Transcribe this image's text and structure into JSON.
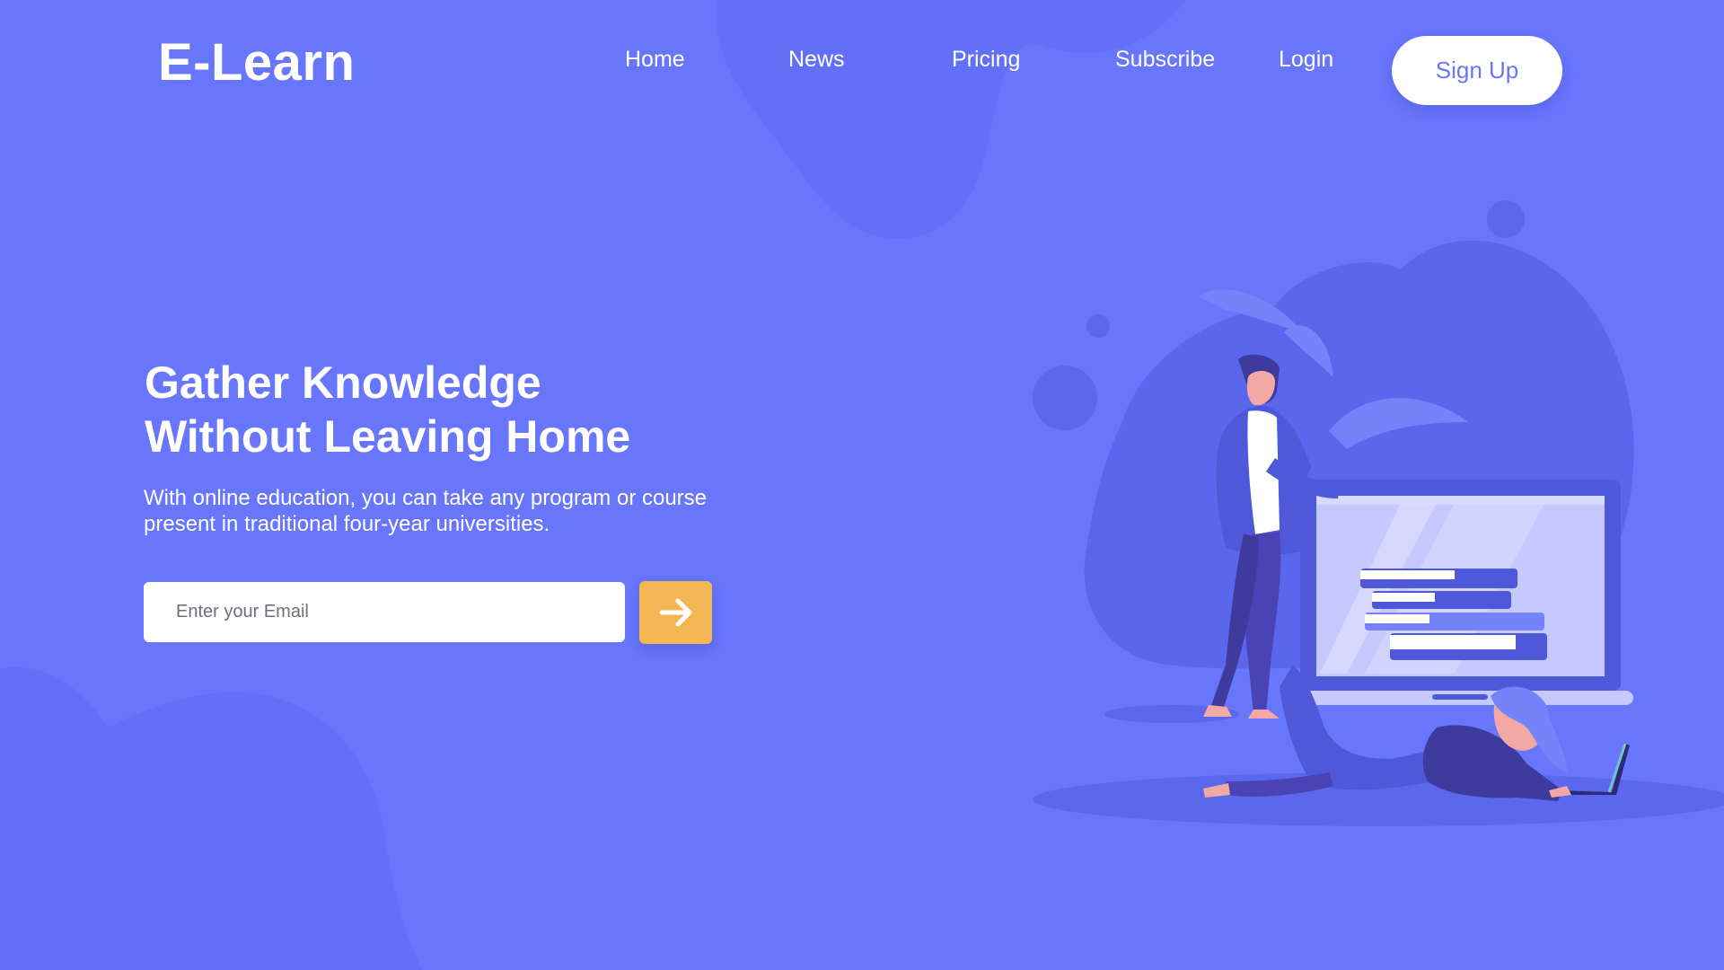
{
  "brand": {
    "name": "E-Learn"
  },
  "nav": {
    "items": [
      {
        "label": "Home"
      },
      {
        "label": "News"
      },
      {
        "label": "Pricing"
      },
      {
        "label": "Subscribe"
      },
      {
        "label": "Login"
      }
    ],
    "signup_label": "Sign Up"
  },
  "hero": {
    "title_line1": "Gather Knowledge",
    "title_line2": "Without Leaving Home",
    "subtitle_line1": "With online education, you can take any program or course",
    "subtitle_line2": "present in traditional four-year universities.",
    "email_placeholder": "Enter your Email",
    "submit_icon": "arrow-right-icon"
  },
  "colors": {
    "background": "#6876FC",
    "blob": "#5E6BF3",
    "accent_button": "#F4B653",
    "text": "#FFFFFF"
  }
}
